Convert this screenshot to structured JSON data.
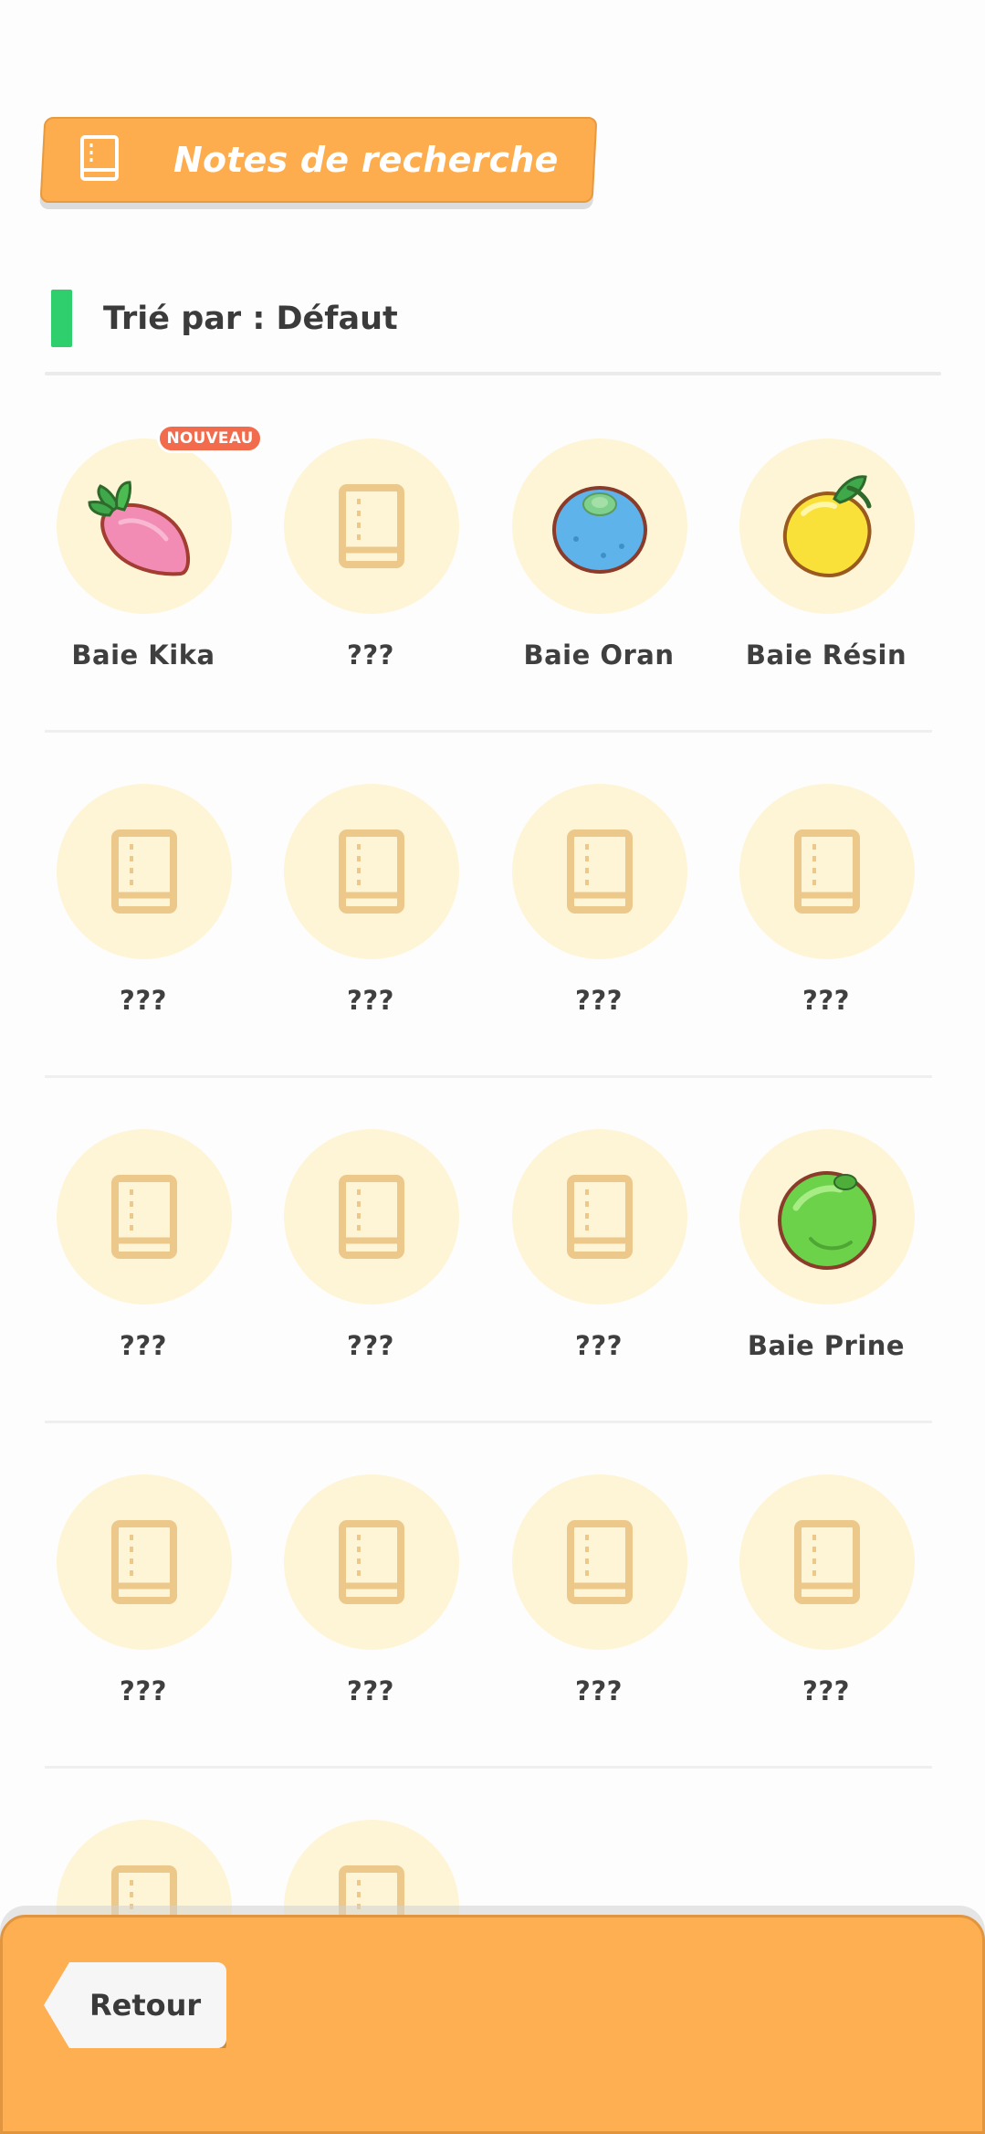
{
  "header": {
    "title": "Notes de recherche",
    "icon": "notebook-icon"
  },
  "sort": {
    "label": "Trié par : Défaut"
  },
  "badge": {
    "new_label": "NOUVEAU"
  },
  "items": [
    {
      "name": "Baie Kika",
      "icon": "pink-berry-icon",
      "discovered": true,
      "new": true
    },
    {
      "name": "???",
      "icon": "notebook-icon",
      "discovered": false
    },
    {
      "name": "Baie Oran",
      "icon": "blue-berry-icon",
      "discovered": true
    },
    {
      "name": "Baie Résin",
      "icon": "yellow-berry-icon",
      "discovered": true
    },
    {
      "name": "???",
      "icon": "notebook-icon",
      "discovered": false
    },
    {
      "name": "???",
      "icon": "notebook-icon",
      "discovered": false
    },
    {
      "name": "???",
      "icon": "notebook-icon",
      "discovered": false
    },
    {
      "name": "???",
      "icon": "notebook-icon",
      "discovered": false
    },
    {
      "name": "???",
      "icon": "notebook-icon",
      "discovered": false
    },
    {
      "name": "???",
      "icon": "notebook-icon",
      "discovered": false
    },
    {
      "name": "???",
      "icon": "notebook-icon",
      "discovered": false
    },
    {
      "name": "Baie Prine",
      "icon": "green-berry-icon",
      "discovered": true
    },
    {
      "name": "???",
      "icon": "notebook-icon",
      "discovered": false
    },
    {
      "name": "???",
      "icon": "notebook-icon",
      "discovered": false
    },
    {
      "name": "???",
      "icon": "notebook-icon",
      "discovered": false
    },
    {
      "name": "???",
      "icon": "notebook-icon",
      "discovered": false
    },
    {
      "name": "",
      "icon": "notebook-icon",
      "discovered": false
    },
    {
      "name": "",
      "icon": "notebook-icon",
      "discovered": false
    }
  ],
  "footer": {
    "back_label": "Retour"
  },
  "colors": {
    "accent_orange": "#fdad4d",
    "sort_green": "#2fcf6d",
    "slot_cream": "#fef5d6",
    "new_badge": "#f26b4c"
  }
}
